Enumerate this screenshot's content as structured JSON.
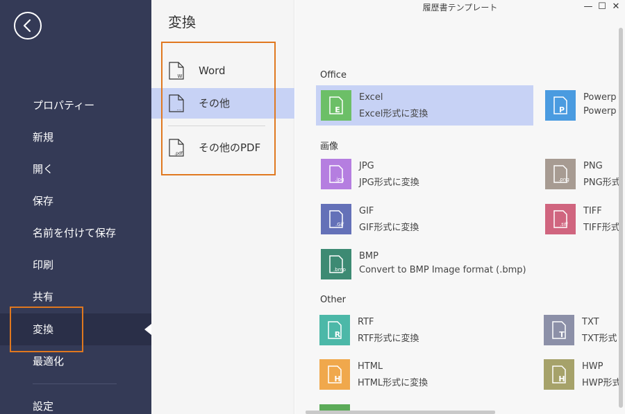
{
  "window": {
    "title": "履歴書テンプレート",
    "minimize": "—",
    "maximize": "☐",
    "close": "✕"
  },
  "sidebar": {
    "items": [
      {
        "label": "プロパティー"
      },
      {
        "label": "新規"
      },
      {
        "label": "開く"
      },
      {
        "label": "保存"
      },
      {
        "label": "名前を付けて保存"
      },
      {
        "label": "印刷"
      },
      {
        "label": "共有"
      },
      {
        "label": "変換"
      },
      {
        "label": "最適化"
      },
      {
        "label": "設定"
      }
    ],
    "active": "変換"
  },
  "middle": {
    "title": "変換",
    "items": [
      {
        "label": "Word",
        "icon_caption": "W"
      },
      {
        "label": "その他",
        "icon_caption": "..."
      },
      {
        "label": "その他のPDF",
        "icon_caption": ".pdf"
      }
    ],
    "selected": "その他"
  },
  "content": {
    "sections": [
      {
        "title": "Office",
        "tiles": [
          {
            "name": "Excel",
            "desc": "Excel形式に変換",
            "badge": "E",
            "color": "#6cbf67"
          },
          {
            "name": "Powerp",
            "desc": "Powerp",
            "badge": "P",
            "color": "#4a9be0"
          }
        ]
      },
      {
        "title": "画像",
        "tiles": [
          {
            "name": "JPG",
            "desc": "JPG形式に変換",
            "badge": ".jpg",
            "color": "#b57ee0"
          },
          {
            "name": "PNG",
            "desc": "PNG形式",
            "badge": ".png",
            "color": "#a79b92"
          },
          {
            "name": "GIF",
            "desc": "GIF形式に変換",
            "badge": ".Gif",
            "color": "#6471b8"
          },
          {
            "name": "TIFF",
            "desc": "TIFF形式",
            "badge": ".tiff",
            "color": "#d0657f"
          },
          {
            "name": "BMP",
            "desc": "Convert to BMP Image format (.bmp)",
            "badge": ".bmp",
            "color": "#3d8a73"
          }
        ]
      },
      {
        "title": "Other",
        "tiles": [
          {
            "name": "RTF",
            "desc": "RTF形式に変換",
            "badge": "R",
            "color": "#4cb8a8"
          },
          {
            "name": "TXT",
            "desc": "TXT形式",
            "badge": "T",
            "color": "#8c90a8"
          },
          {
            "name": "HTML",
            "desc": "HTML形式に変換",
            "badge": "H",
            "color": "#f0a84c"
          },
          {
            "name": "HWP",
            "desc": "HWP形式",
            "badge": "H",
            "color": "#a6a26a"
          }
        ]
      }
    ],
    "selected_tile": "Excel"
  },
  "colors": {
    "sidebar_bg": "#343a56",
    "active_nav_bg": "#2a2f48",
    "selection_bg": "#c7d2f5",
    "highlight_box": "#e0781f"
  }
}
